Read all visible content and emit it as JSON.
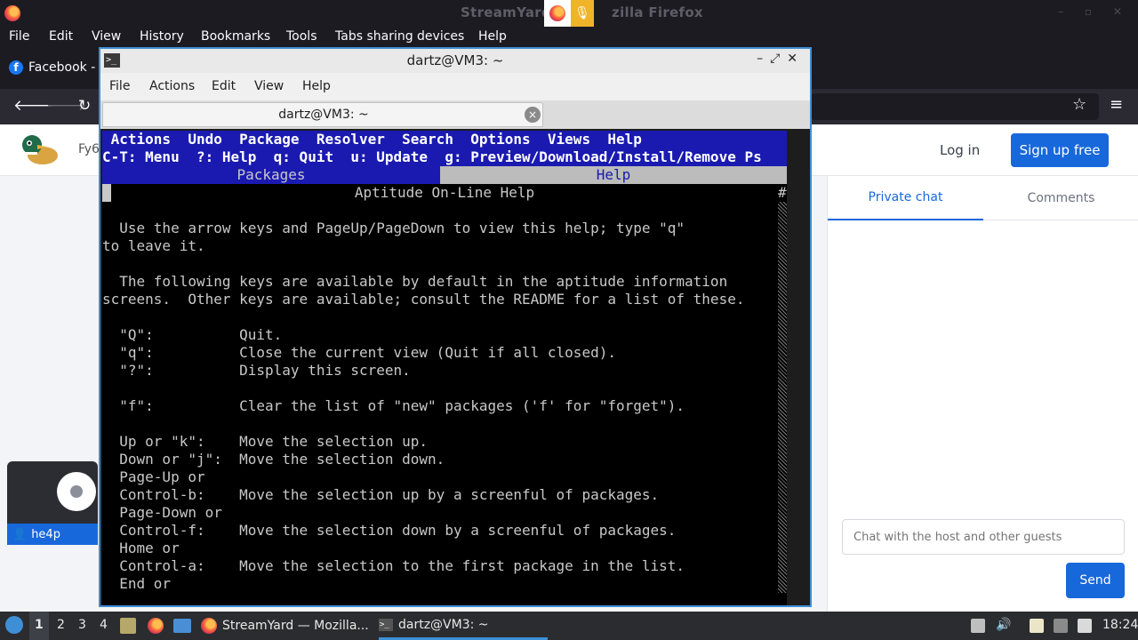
{
  "firefox": {
    "window_title": "StreamYard — Mozilla Firefox",
    "title_visible_left": "StreamYard",
    "title_visible_right": "zilla Firefox",
    "menu": [
      "File",
      "Edit",
      "View",
      "History",
      "Bookmarks",
      "Tools",
      "Tabs sharing devices",
      "Help"
    ],
    "tab_facebook": "Facebook - I",
    "nav_icons": [
      "back-arrow-icon",
      "forward-arrow-icon",
      "reload-icon",
      "star-icon",
      "hamburger-menu-icon"
    ]
  },
  "streamyard": {
    "brand_partial": "Fy6",
    "login": "Log in",
    "signup": "Sign up free",
    "tabs": {
      "private": "Private chat",
      "comments": "Comments"
    },
    "chat_placeholder": "Chat with the host and other guests",
    "send": "Send",
    "guest_name": "he4p",
    "colors": {
      "accent": "#1768db"
    }
  },
  "terminal": {
    "title": "dartz@VM3: ~",
    "menu": [
      "File",
      "Actions",
      "Edit",
      "View",
      "Help"
    ],
    "tab_label": "dartz@VM3: ~",
    "aptitude": {
      "menubar": " Actions  Undo  Package  Resolver  Search  Options  Views  Help",
      "keys": "C-T: Menu  ?: Help  q: Quit  u: Update  g: Preview/Download/Install/Remove Ps",
      "tab_packages": "Packages",
      "tab_help": "Help",
      "help_title": "Aptitude On-Line Help",
      "hash": "#",
      "lines": [
        "",
        "  Use the arrow keys and PageUp/PageDown to view this help; type \"q\"",
        "to leave it.",
        "",
        "  The following keys are available by default in the aptitude information",
        "screens.  Other keys are available; consult the README for a list of these.",
        "",
        "  \"Q\":          Quit.",
        "  \"q\":          Close the current view (Quit if all closed).",
        "  \"?\":          Display this screen.",
        "",
        "  \"f\":          Clear the list of \"new\" packages ('f' for \"forget\").",
        "",
        "  Up or \"k\":    Move the selection up.",
        "  Down or \"j\":  Move the selection down.",
        "  Page-Up or",
        "  Control-b:    Move the selection up by a screenful of packages.",
        "  Page-Down or",
        "  Control-f:    Move the selection down by a screenful of packages.",
        "  Home or",
        "  Control-a:    Move the selection to the first package in the list.",
        "  End or"
      ]
    }
  },
  "taskbar": {
    "workspaces": [
      "1",
      "2",
      "3",
      "4"
    ],
    "task_firefox": "StreamYard — Mozilla...",
    "task_terminal": "dartz@VM3: ~",
    "clock": "18:24"
  }
}
